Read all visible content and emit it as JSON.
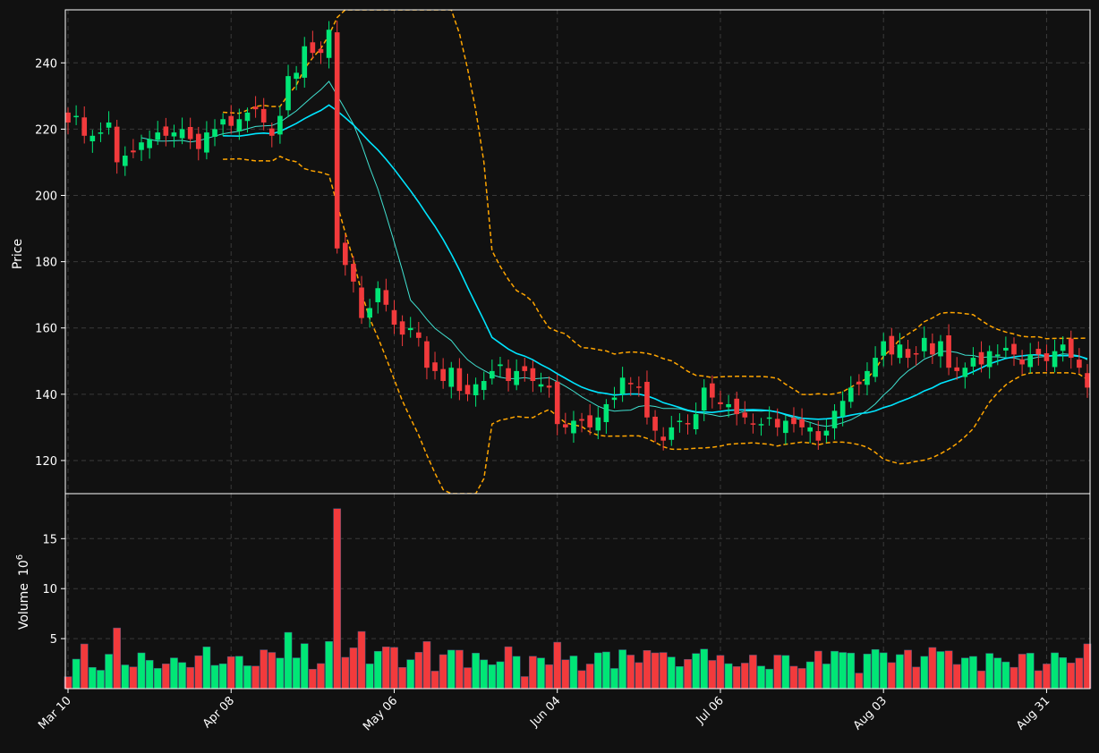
{
  "chart_data": {
    "type": "candlestick",
    "colors": {
      "up": "#00e676",
      "down": "#f23a3c",
      "background": "#111111",
      "grid": "#3a3a3a",
      "ma_fast": "#40e0d0",
      "ma_slow": "#00e5ff",
      "bands": "#ffa500"
    },
    "price_panel": {
      "ylabel": "Price",
      "ylim": [
        110,
        256
      ],
      "yticks": [
        120,
        140,
        160,
        180,
        200,
        220,
        240
      ],
      "grid": true
    },
    "volume_panel": {
      "ylabel": "Volume",
      "ylabel_exponent": "10",
      "ylabel_exponent_power": "6",
      "ylim": [
        0,
        19.5
      ],
      "yticks": [
        5,
        10,
        15
      ],
      "grid": true
    },
    "xaxis": {
      "ticks": [
        {
          "label": "Mar 10",
          "index": 0
        },
        {
          "label": "Apr 08",
          "index": 20
        },
        {
          "label": "May 06",
          "index": 40
        },
        {
          "label": "Jun 04",
          "index": 60
        },
        {
          "label": "Jul 06",
          "index": 80
        },
        {
          "label": "Aug 03",
          "index": 100
        },
        {
          "label": "Aug 31",
          "index": 120
        }
      ],
      "tick_rotation": 45
    },
    "close": [
      222,
      224,
      218,
      218,
      219,
      222,
      210,
      212,
      213,
      216,
      217,
      219,
      218,
      219,
      220,
      217,
      214,
      219,
      220,
      223,
      221,
      223,
      225,
      226,
      222,
      218,
      224,
      236,
      237,
      245,
      243,
      243,
      250,
      184,
      179,
      174,
      163,
      166,
      172,
      167,
      161,
      158,
      160,
      157,
      148,
      147,
      144,
      148,
      141,
      140,
      143,
      144,
      147,
      149,
      144,
      147,
      147,
      144,
      143,
      142,
      131,
      130,
      132,
      132,
      130,
      133,
      137,
      139,
      145,
      143,
      142,
      133,
      129,
      126,
      130,
      132,
      131,
      134,
      142,
      139,
      137,
      137,
      134,
      133,
      131,
      131,
      133,
      130,
      132,
      131,
      130,
      130,
      126,
      129,
      135,
      138,
      142,
      143,
      147,
      151,
      156,
      152,
      155,
      151,
      152,
      157,
      152,
      156,
      148,
      147,
      148,
      151,
      149,
      153,
      152,
      154,
      152,
      149,
      152,
      152,
      150,
      153,
      155,
      151,
      148,
      142
    ]
  }
}
